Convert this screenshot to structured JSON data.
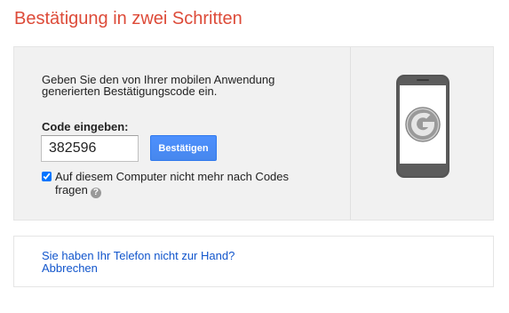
{
  "page": {
    "title": "Bestätigung in zwei Schritten"
  },
  "verify": {
    "instructions": "Geben Sie den von Ihrer mobilen Anwendung generierten Bestätigungscode ein.",
    "code_label": "Code eingeben:",
    "code_value": "382596",
    "verify_button": "Bestätigen",
    "remember_checked": true,
    "remember_label": "Auf diesem Computer nicht mehr nach Codes fragen",
    "help_icon": "question-mark-icon",
    "help_glyph": "?",
    "illustration": "smartphone-with-google-logo"
  },
  "alternatives": {
    "no_phone_link": "Sie haben Ihr Telefon nicht zur Hand?",
    "cancel_link": "Abbrechen"
  },
  "colors": {
    "title": "#dd4b39",
    "button": "#4d90fe",
    "link": "#1155cc",
    "panel": "#f1f1f1"
  }
}
